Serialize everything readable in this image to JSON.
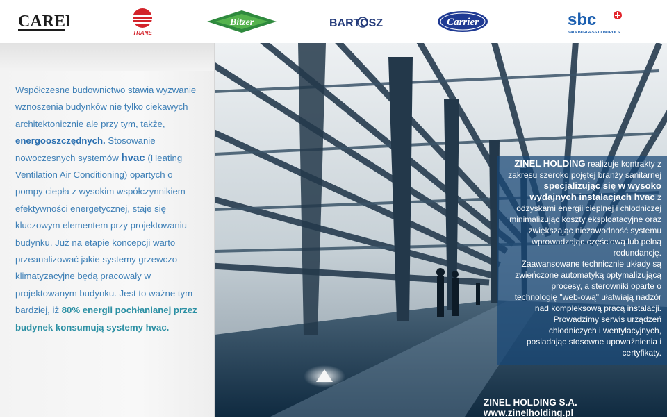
{
  "logos": {
    "carel": "CAREL",
    "trane": "TRANE",
    "bitzer": "Bitzer",
    "bartosz": "BARTOSZ",
    "carrier": "Carrier",
    "sbc": "sbc",
    "sbc_sub": "SAIA BURGESS CONTROLS"
  },
  "left_text": {
    "l1": "Współczesne budownictwo stawia wyzwanie",
    "l2": "wznoszenia budynków nie tylko ciekawych",
    "l3": "architektonicznie ale przy tym, także,",
    "l4a": "energooszczędnych.",
    "l4b": " Stosowanie",
    "l5a": "nowoczesnych systemów ",
    "l5b": "hvac",
    "l5c": " (Heating",
    "l6": "Ventilation Air Conditioning) opartych o",
    "l7": "pompy ciepła z wysokim współczynnikiem",
    "l8": "efektywności energetycznej, staje się",
    "l9": "kluczowym elementem przy projektowaniu",
    "l10": "budynku. Już na etapie koncepcji warto",
    "l11": "przeanalizować jakie systemy grzewczo-",
    "l12": "klimatyzacyjne będą pracowały w",
    "l13": "projektowanym budynku. Jest to ważne tym",
    "l14a": "bardziej, iż ",
    "l14b": "80% energii pochłanianej przez",
    "l15": "budynek konsumują systemy hvac."
  },
  "blue_text": {
    "b1a": "ZINEL HOLDING",
    "b1b": " realizuje kontrakty z",
    "b2": "zakresu szeroko pojętej branży sanitarnej",
    "b3": "specjalizując się w wysoko",
    "b4a": "wydajnych instalacjach hvac",
    "b4b": " z",
    "b5": "odzyskami energii cieplnej i chłodniczej",
    "b6": "minimalizując koszty eksploatacyjne oraz",
    "b7": "zwiększając niezawodność systemu",
    "b8": "wprowadzając częściową lub pełną",
    "b9": "redundancję.",
    "b10": "Zaawansowane technicznie układy są",
    "b11": "zwieńczone automatyką optymalizującą",
    "b12": "procesy, a sterowniki oparte o",
    "b13": "technologię \"web-ową\" ułatwiają nadzór",
    "b14": "nad kompleksową pracą instalacji.",
    "b15": "Prowadzimy serwis urządzeń",
    "b16": "chłodniczych i wentylacyjnych,",
    "b17": "posiadając stosowne upoważnienia i",
    "b18": "certyfikaty."
  },
  "footer": "ZINEL HOLDING S.A. www.zinelholding.pl"
}
